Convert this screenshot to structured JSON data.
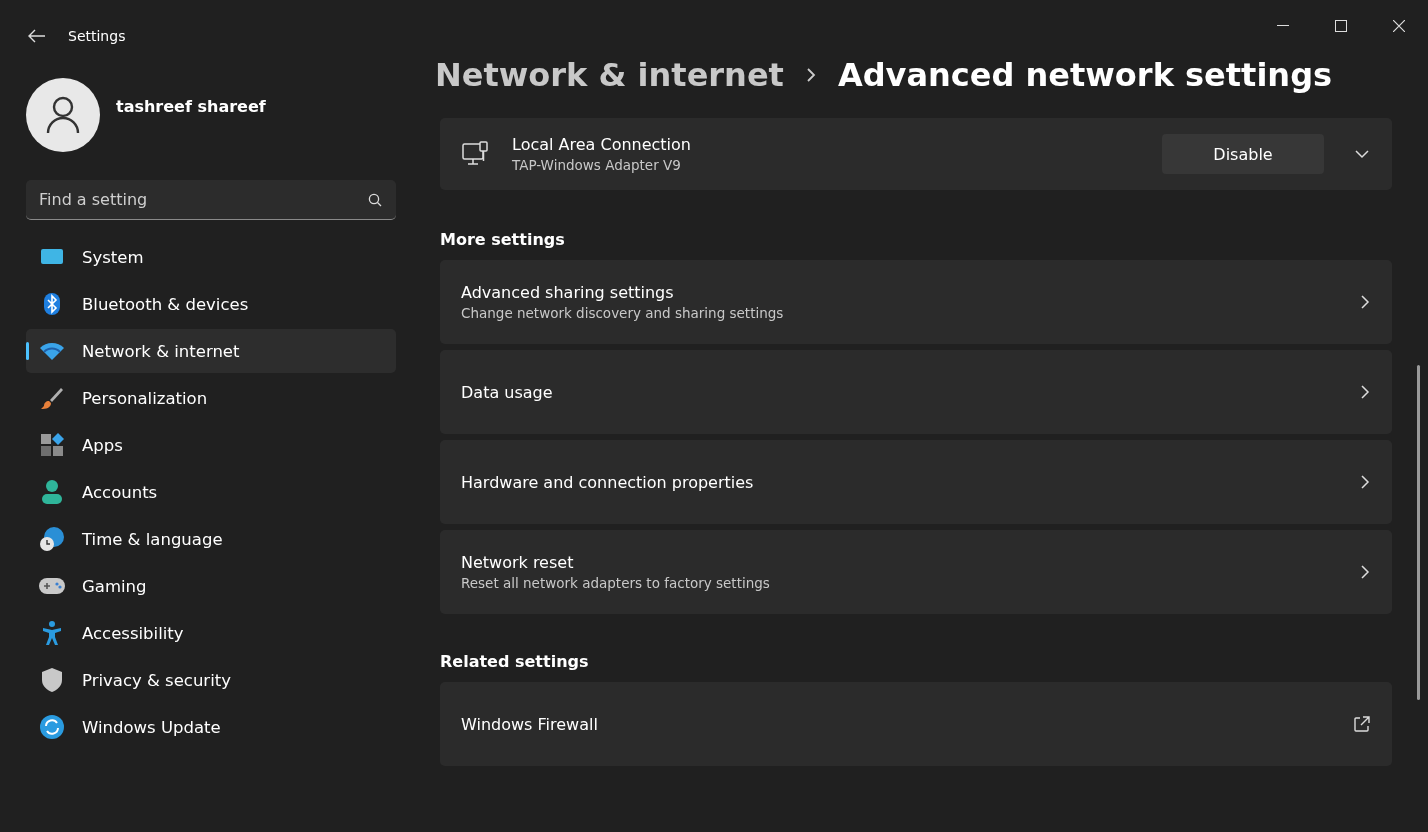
{
  "window": {
    "title": "Settings"
  },
  "user": {
    "name": "tashreef shareef"
  },
  "search": {
    "placeholder": "Find a setting"
  },
  "nav": [
    {
      "label": "System",
      "kind": "system",
      "selected": false
    },
    {
      "label": "Bluetooth & devices",
      "kind": "bluetooth",
      "selected": false
    },
    {
      "label": "Network & internet",
      "kind": "network",
      "selected": true
    },
    {
      "label": "Personalization",
      "kind": "brush",
      "selected": false
    },
    {
      "label": "Apps",
      "kind": "apps",
      "selected": false
    },
    {
      "label": "Accounts",
      "kind": "accounts",
      "selected": false
    },
    {
      "label": "Time & language",
      "kind": "time",
      "selected": false
    },
    {
      "label": "Gaming",
      "kind": "gaming",
      "selected": false
    },
    {
      "label": "Accessibility",
      "kind": "accessibility",
      "selected": false
    },
    {
      "label": "Privacy & security",
      "kind": "privacy",
      "selected": false
    },
    {
      "label": "Windows Update",
      "kind": "update",
      "selected": false
    }
  ],
  "breadcrumb": {
    "parent": "Network & internet",
    "current": "Advanced network settings"
  },
  "adapter": {
    "name": "Local Area Connection",
    "description": "TAP-Windows Adapter V9",
    "button": "Disable",
    "expanded": false
  },
  "sections": [
    {
      "title": "More settings",
      "items": [
        {
          "title": "Advanced sharing settings",
          "subtitle": "Change network discovery and sharing settings",
          "kind": "chevron"
        },
        {
          "title": "Data usage",
          "kind": "chevron"
        },
        {
          "title": "Hardware and connection properties",
          "kind": "chevron"
        },
        {
          "title": "Network reset",
          "subtitle": "Reset all network adapters to factory settings",
          "kind": "chevron"
        }
      ]
    },
    {
      "title": "Related settings",
      "items": [
        {
          "title": "Windows Firewall",
          "kind": "external"
        }
      ]
    }
  ]
}
